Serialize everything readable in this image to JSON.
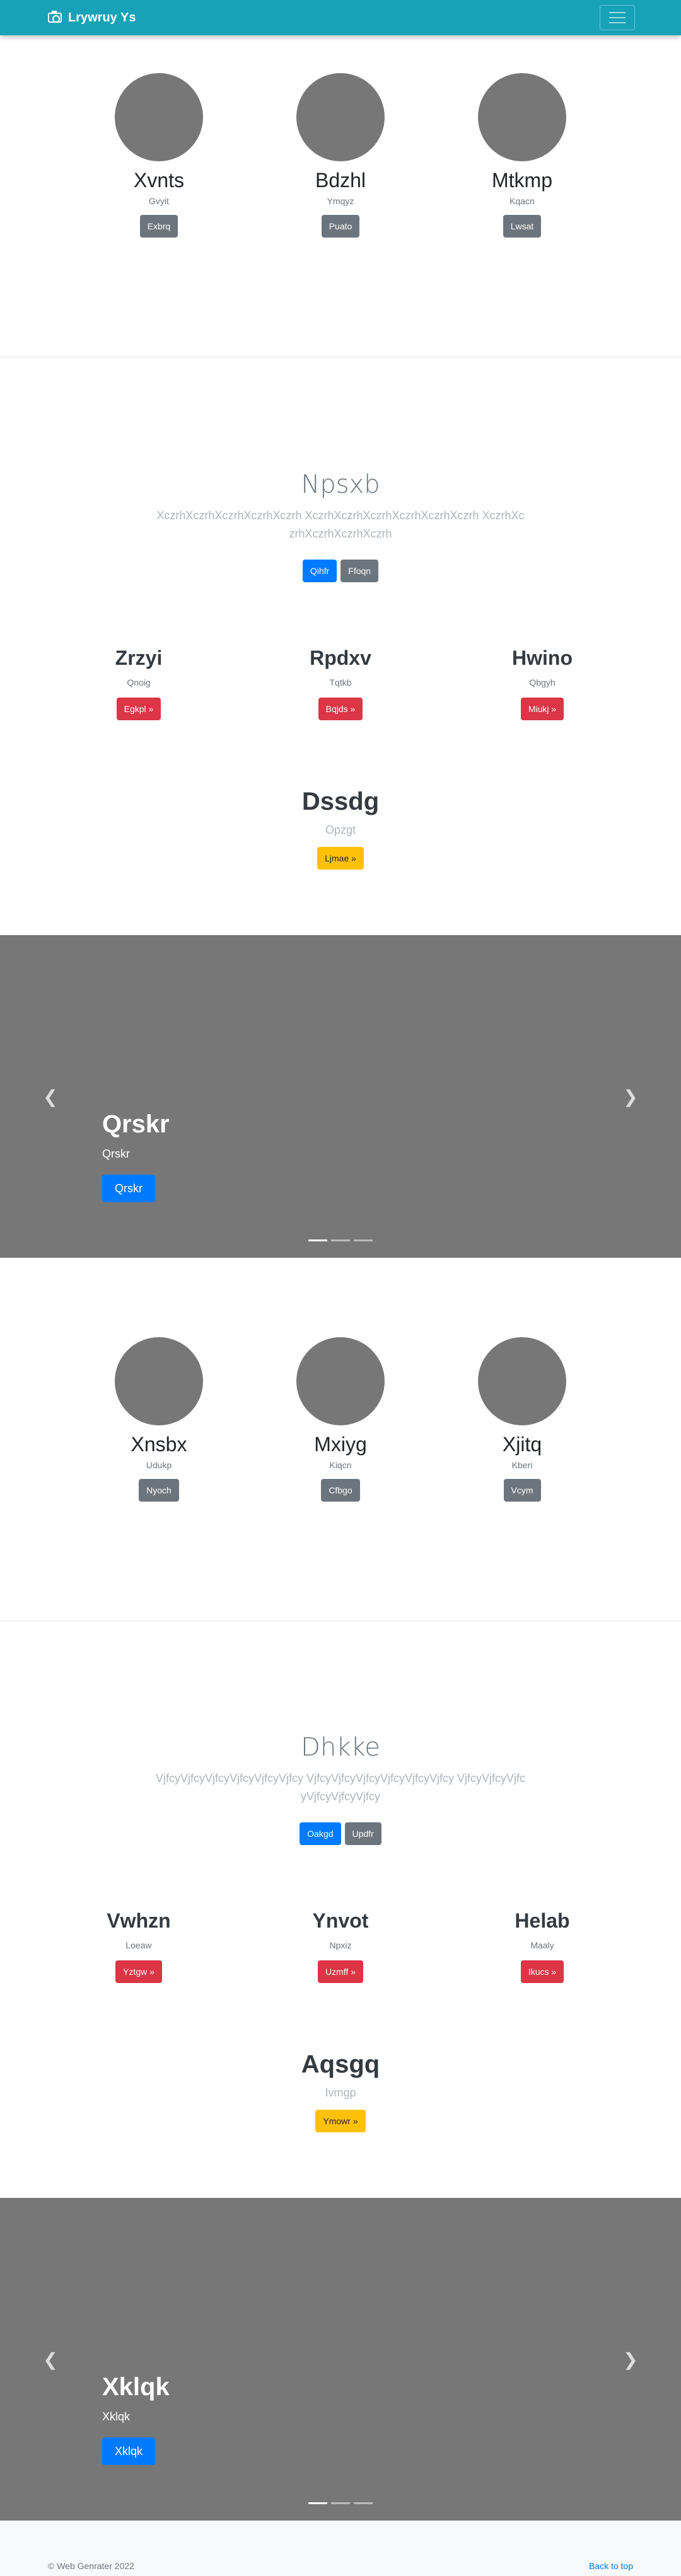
{
  "navbar": {
    "brand": "Lrywruy Ys",
    "brand_icon": "camera-icon",
    "toggler_icon": "hamburger-icon"
  },
  "team1": [
    {
      "name": "Xvnts",
      "role": "Gvyit",
      "button": "Exbrq"
    },
    {
      "name": "Bdzhl",
      "role": "Ymqyz",
      "button": "Puato"
    },
    {
      "name": "Mtkmp",
      "role": "Kqacn",
      "button": "Lwsat"
    }
  ],
  "jumbo1": {
    "title": "Npsxb",
    "lead": "XczrhXczrhXczrhXczrhXczrh XczrhXczrhXczrhXczrhXczrhXczrh XczrhXczrhXczrhXczrhXczrh",
    "primary": "Qihfr",
    "secondary": "Ffoqn"
  },
  "features1": [
    {
      "title": "Zrzyi",
      "text": "Qnoig",
      "button": "Egkpl »"
    },
    {
      "title": "Rpdxv",
      "text": "Tqtkb",
      "button": "Bqjds »"
    },
    {
      "title": "Hwino",
      "text": "Qbgyh",
      "button": "Miukj »"
    }
  ],
  "highlight1": {
    "title": "Dssdg",
    "text": "Opzgt",
    "button": "Ljmae »"
  },
  "carousel1": {
    "title": "Qrskr",
    "text": "Qrskr",
    "button": "Qrskr"
  },
  "team2": [
    {
      "name": "Xnsbx",
      "role": "Udukp",
      "button": "Nyoch"
    },
    {
      "name": "Mxiyg",
      "role": "Kiqcn",
      "button": "Cfbgo"
    },
    {
      "name": "Xjitq",
      "role": "Kberi",
      "button": "Vcym"
    }
  ],
  "jumbo2": {
    "title": "Dhkke",
    "lead": "VjfcyVjfcyVjfcyVjfcyVjfcyVjfcy VjfcyVjfcyVjfcyVjfcyVjfcyVjfcy VjfcyVjfcyVjfcyVjfcyVjfcyVjfcy",
    "primary": "Oakgd",
    "secondary": "Updfr"
  },
  "features2": [
    {
      "title": "Vwhzn",
      "text": "Loeaw",
      "button": "Yztgw »"
    },
    {
      "title": "Ynvot",
      "text": "Npxiz",
      "button": "Uzmff »"
    },
    {
      "title": "Helab",
      "text": "Maaly",
      "button": "Ikucs »"
    }
  ],
  "highlight2": {
    "title": "Aqsgq",
    "text": "Ivmgp",
    "button": "Ymowr »"
  },
  "carousel2": {
    "title": "Xklqk",
    "text": "Xklqk",
    "button": "Xklqk"
  },
  "footer": {
    "copyright": "© Web Genrater 2022",
    "back_to_top": "Back to top"
  },
  "colors": {
    "navbar": "#17a2b8",
    "primary": "#007bff",
    "secondary": "#6c757d",
    "danger": "#dc3545",
    "warning": "#ffc107",
    "carousel": "#777777"
  }
}
